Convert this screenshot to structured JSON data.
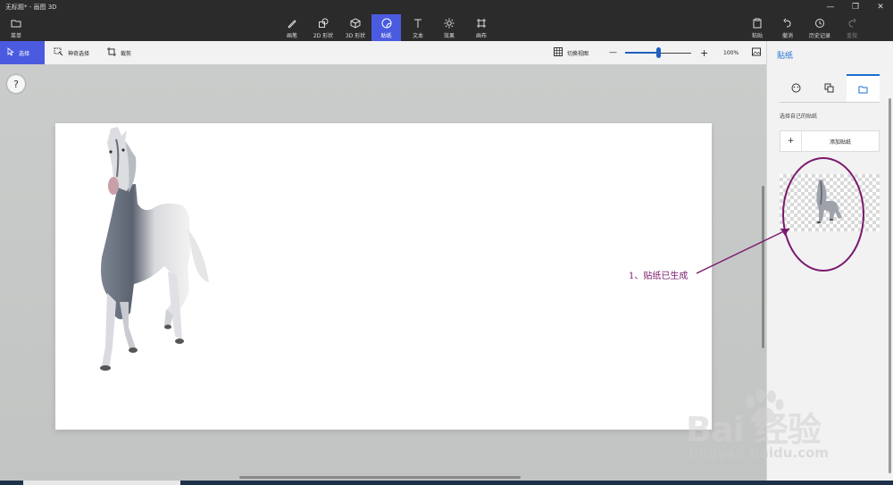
{
  "window": {
    "title": "无标题* - 画图 3D",
    "minimize_glyph": "—",
    "restore_glyph": "❐",
    "close_glyph": "✕"
  },
  "toolbar": {
    "menu_label": "菜单",
    "tools": [
      {
        "label": "画笔",
        "icon": "brush-icon"
      },
      {
        "label": "2D 形状",
        "icon": "2d-shapes-icon"
      },
      {
        "label": "3D 形状",
        "icon": "3d-shapes-icon"
      },
      {
        "label": "贴纸",
        "icon": "sticker-icon",
        "active": true
      },
      {
        "label": "文本",
        "icon": "text-icon"
      },
      {
        "label": "效果",
        "icon": "effects-icon"
      },
      {
        "label": "画布",
        "icon": "canvas-icon"
      }
    ],
    "paste_label": "粘贴",
    "undo_label": "撤消",
    "history_label": "历史记录",
    "redo_label": "重做"
  },
  "subbar": {
    "select_label": "选择",
    "magic_select_label": "神奇选择",
    "crop_label": "裁剪",
    "toggle_view_label": "切换视图",
    "zoom_minus": "—",
    "zoom_plus": "+",
    "zoom_level": 100,
    "zoom_level_text": "100%",
    "zoom_slider_fraction": 0.5
  },
  "workspace": {
    "help_label": "?"
  },
  "panel": {
    "title": "贴纸",
    "tabs": [
      {
        "icon": "sticker-shapes-icon"
      },
      {
        "icon": "texture-icon"
      },
      {
        "icon": "custom-sticker-folder-icon",
        "selected": true
      }
    ],
    "section_label": "选择自己的贴纸",
    "add_plus": "+",
    "add_sticker_label": "添加贴纸"
  },
  "annotation": {
    "text": "1、贴纸已生成",
    "color": "#7a1a6e"
  },
  "watermark": {
    "main": "Bai  经验",
    "sub": "jingyan.baidu.com"
  },
  "colors": {
    "accent": "#4b5be0",
    "panel_title": "#1a6fd0",
    "chrome": "#2b2b2b"
  }
}
